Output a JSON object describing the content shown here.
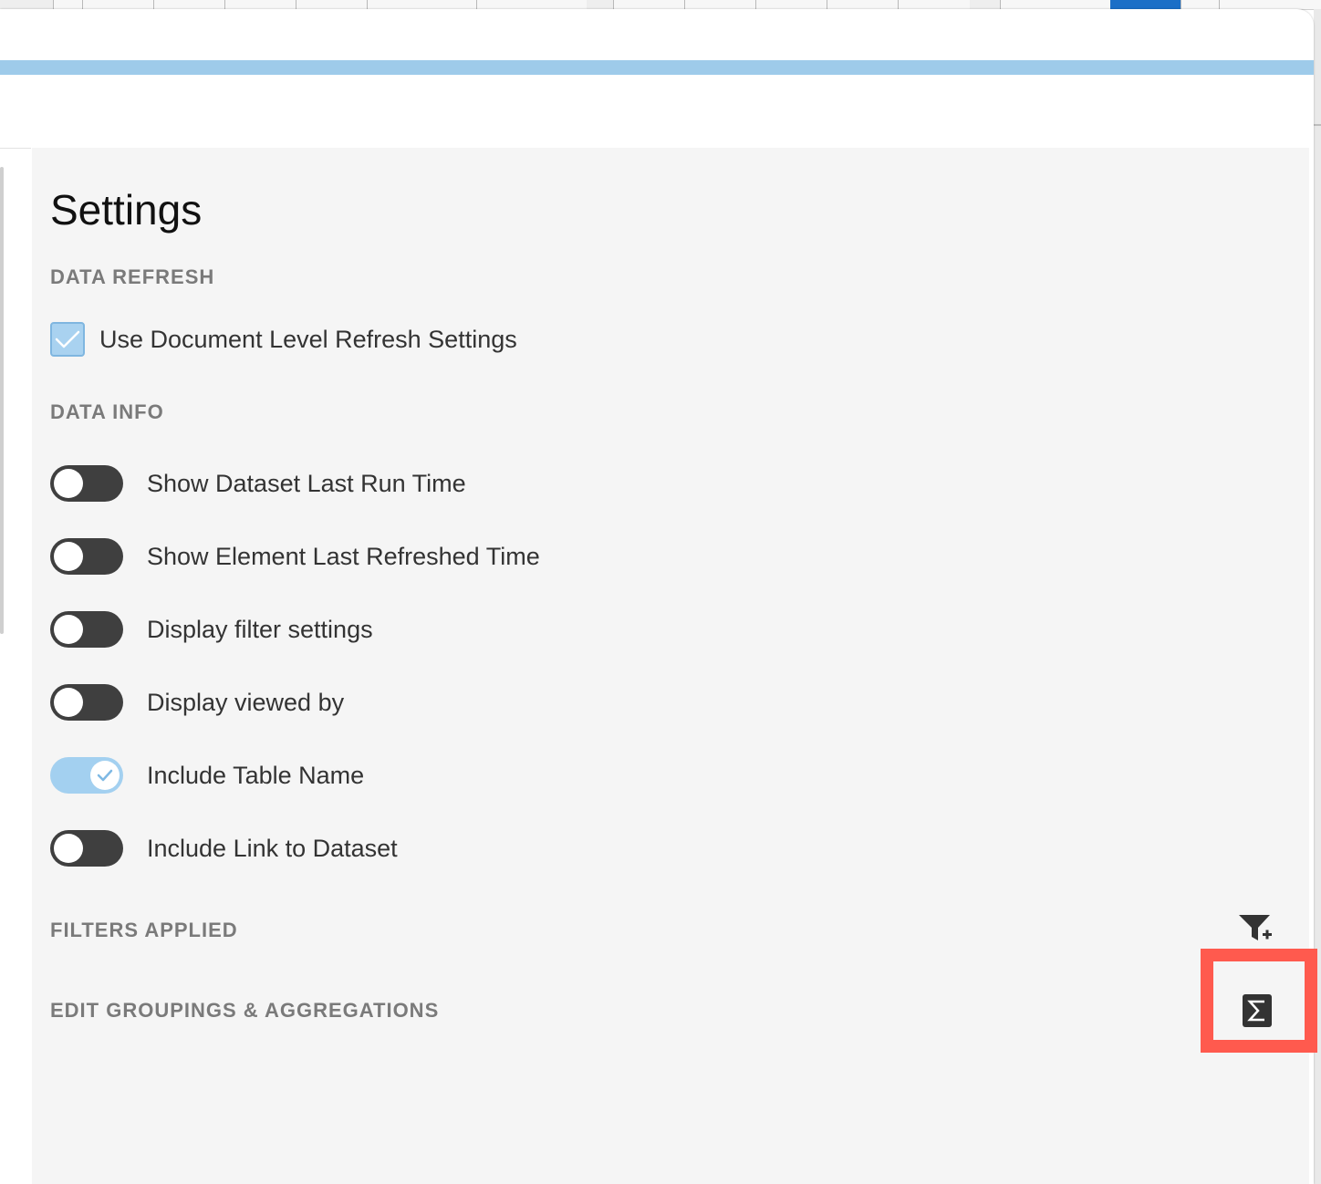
{
  "settings": {
    "title": "Settings",
    "accent_color": "#9ecbea",
    "highlight_color": "#ff5a4e",
    "data_refresh": {
      "heading": "DATA REFRESH",
      "use_document_level": {
        "label": "Use Document Level Refresh Settings",
        "checked": true
      }
    },
    "data_info": {
      "heading": "DATA INFO",
      "toggles": [
        {
          "label": "Show Dataset Last Run Time",
          "on": false
        },
        {
          "label": "Show Element Last Refreshed Time",
          "on": false
        },
        {
          "label": "Display filter settings",
          "on": false
        },
        {
          "label": "Display viewed by",
          "on": false
        },
        {
          "label": "Include Table Name",
          "on": true
        },
        {
          "label": "Include Link to Dataset",
          "on": false
        }
      ]
    },
    "filters_applied": {
      "heading": "FILTERS APPLIED",
      "action_icon": "filter-add-icon"
    },
    "groupings": {
      "heading": "EDIT GROUPINGS & AGGREGATIONS",
      "action_icon": "sigma-icon",
      "highlighted": true
    }
  }
}
